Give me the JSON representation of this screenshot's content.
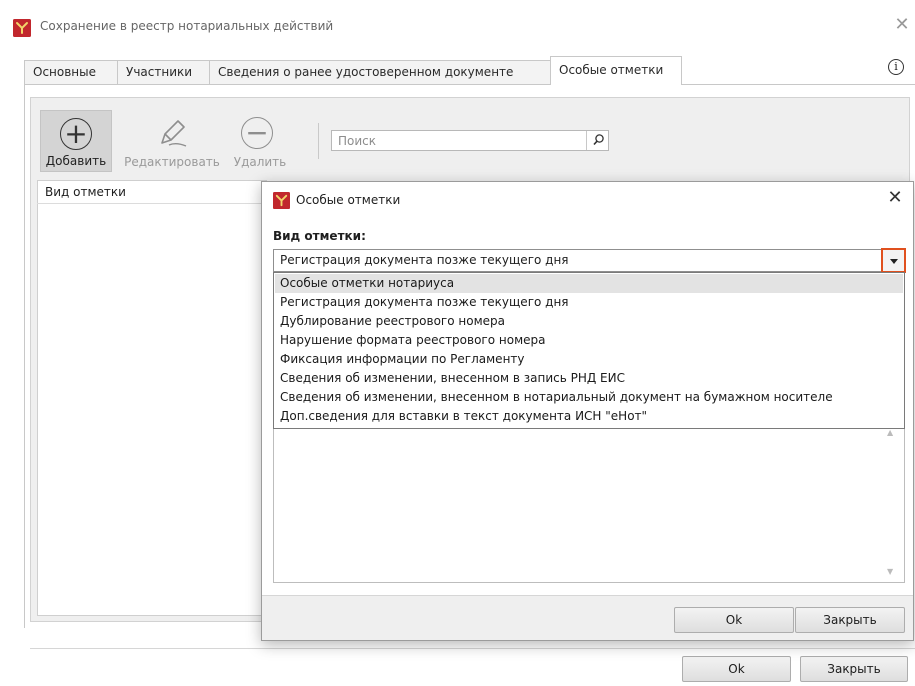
{
  "window": {
    "title": "Сохранение в реестр нотариальных действий",
    "close_glyph": "✕",
    "app_icon": "app-logo-icon"
  },
  "tabs": [
    {
      "label": "Основные",
      "active": false
    },
    {
      "label": "Участники",
      "active": false
    },
    {
      "label": "Сведения о ранее удостоверенном документе",
      "active": false
    },
    {
      "label": "Особые отметки",
      "active": true
    }
  ],
  "info_icon_glyph": "i",
  "toolbar": {
    "add_label": "Добавить",
    "add_glyph": "+",
    "edit_label": "Редактировать",
    "delete_label": "Удалить",
    "delete_glyph": "−"
  },
  "search": {
    "placeholder": "Поиск",
    "value": ""
  },
  "list": {
    "header": "Вид отметки",
    "rows": []
  },
  "footer": {
    "ok_label": "Ok",
    "close_label": "Закрыть"
  },
  "dialog": {
    "title": "Особые отметки",
    "close_glyph": "✕",
    "field_label": "Вид отметки:",
    "selected_value": "Регистрация документа позже текущего дня",
    "options": [
      "Особые отметки нотариуса",
      "Регистрация документа позже текущего дня",
      "Дублирование реестрового номера",
      "Нарушение формата реестрового номера",
      "Фиксация информации по Регламенту",
      "Сведения об изменении, внесенном в запись РНД ЕИС",
      "Сведения об изменении, внесенном в нотариальный документ на бумажном носителе",
      "Доп.сведения для вставки в текст документа ИСН \"еНот\""
    ],
    "highlighted_option_index": 0,
    "ok_label": "Ok",
    "close_label": "Закрыть"
  },
  "colors": {
    "accent_red": "#c1272d",
    "focus_orange": "#e0501e",
    "highlight": "#e3e3e3"
  }
}
